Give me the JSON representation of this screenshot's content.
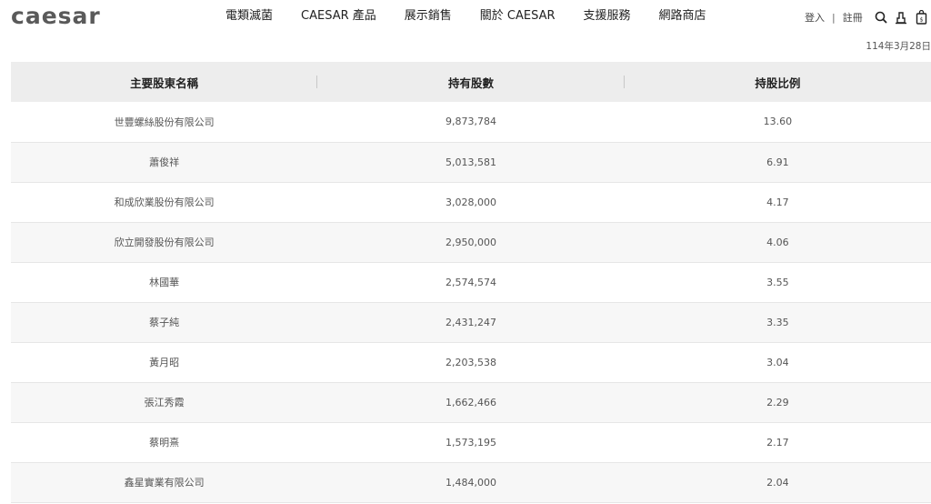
{
  "header": {
    "logo": "caesar",
    "nav": [
      "電類滅菌",
      "CAESAR 產品",
      "展示銷售",
      "關於 CAESAR",
      "支援服務",
      "網路商店"
    ],
    "login": "登入",
    "separator": "|",
    "register": "註冊",
    "icons": [
      "search-icon",
      "user-icon",
      "cart-icon"
    ]
  },
  "date": "114年3月28日",
  "table": {
    "headers": [
      "主要股東名稱",
      "持有股數",
      "持股比例"
    ],
    "rows": [
      [
        "世豐螺絲股份有限公司",
        "9,873,784",
        "13.60"
      ],
      [
        "蕭俊祥",
        "5,013,581",
        "6.91"
      ],
      [
        "和成欣業股份有限公司",
        "3,028,000",
        "4.17"
      ],
      [
        "欣立開發股份有限公司",
        "2,950,000",
        "4.06"
      ],
      [
        "林國華",
        "2,574,574",
        "3.55"
      ],
      [
        "蔡子純",
        "2,431,247",
        "3.35"
      ],
      [
        "黃月昭",
        "2,203,538",
        "3.04"
      ],
      [
        "張江秀霞",
        "1,662,466",
        "2.29"
      ],
      [
        "蔡明熹",
        "1,573,195",
        "2.17"
      ],
      [
        "鑫星實業有限公司",
        "1,484,000",
        "2.04"
      ]
    ]
  }
}
